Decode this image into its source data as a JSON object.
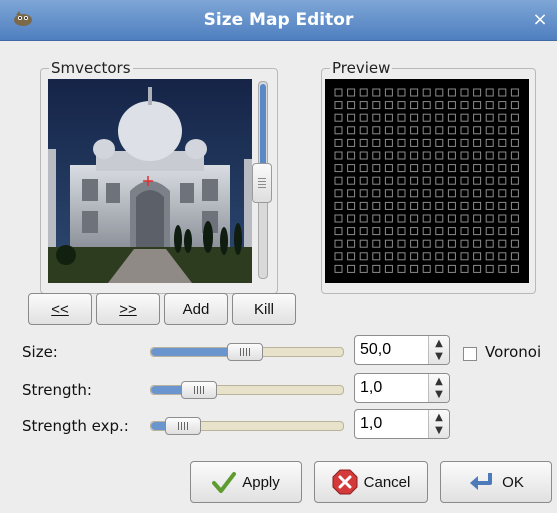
{
  "window": {
    "title": "Size Map Editor",
    "close_glyph": "×",
    "icon": "gimp-icon"
  },
  "smvectors": {
    "label": "Smvectors"
  },
  "preview": {
    "label": "Preview"
  },
  "nav_buttons": {
    "prev": "<<",
    "next": ">>",
    "add": "Add",
    "kill": "Kill"
  },
  "controls": {
    "size": {
      "label": "Size:",
      "value": "50,0"
    },
    "voronoi": {
      "label": "Voronoi",
      "checked": false
    },
    "strength": {
      "label": "Strength:",
      "value": "1,0"
    },
    "strength_exp": {
      "label": "Strength exp.:",
      "value": "1,0"
    }
  },
  "bottom_buttons": {
    "apply": "Apply",
    "cancel": "Cancel",
    "ok": "OK"
  },
  "colors": {
    "titlebar": "#5b88c6",
    "accent": "#5a89c8"
  }
}
